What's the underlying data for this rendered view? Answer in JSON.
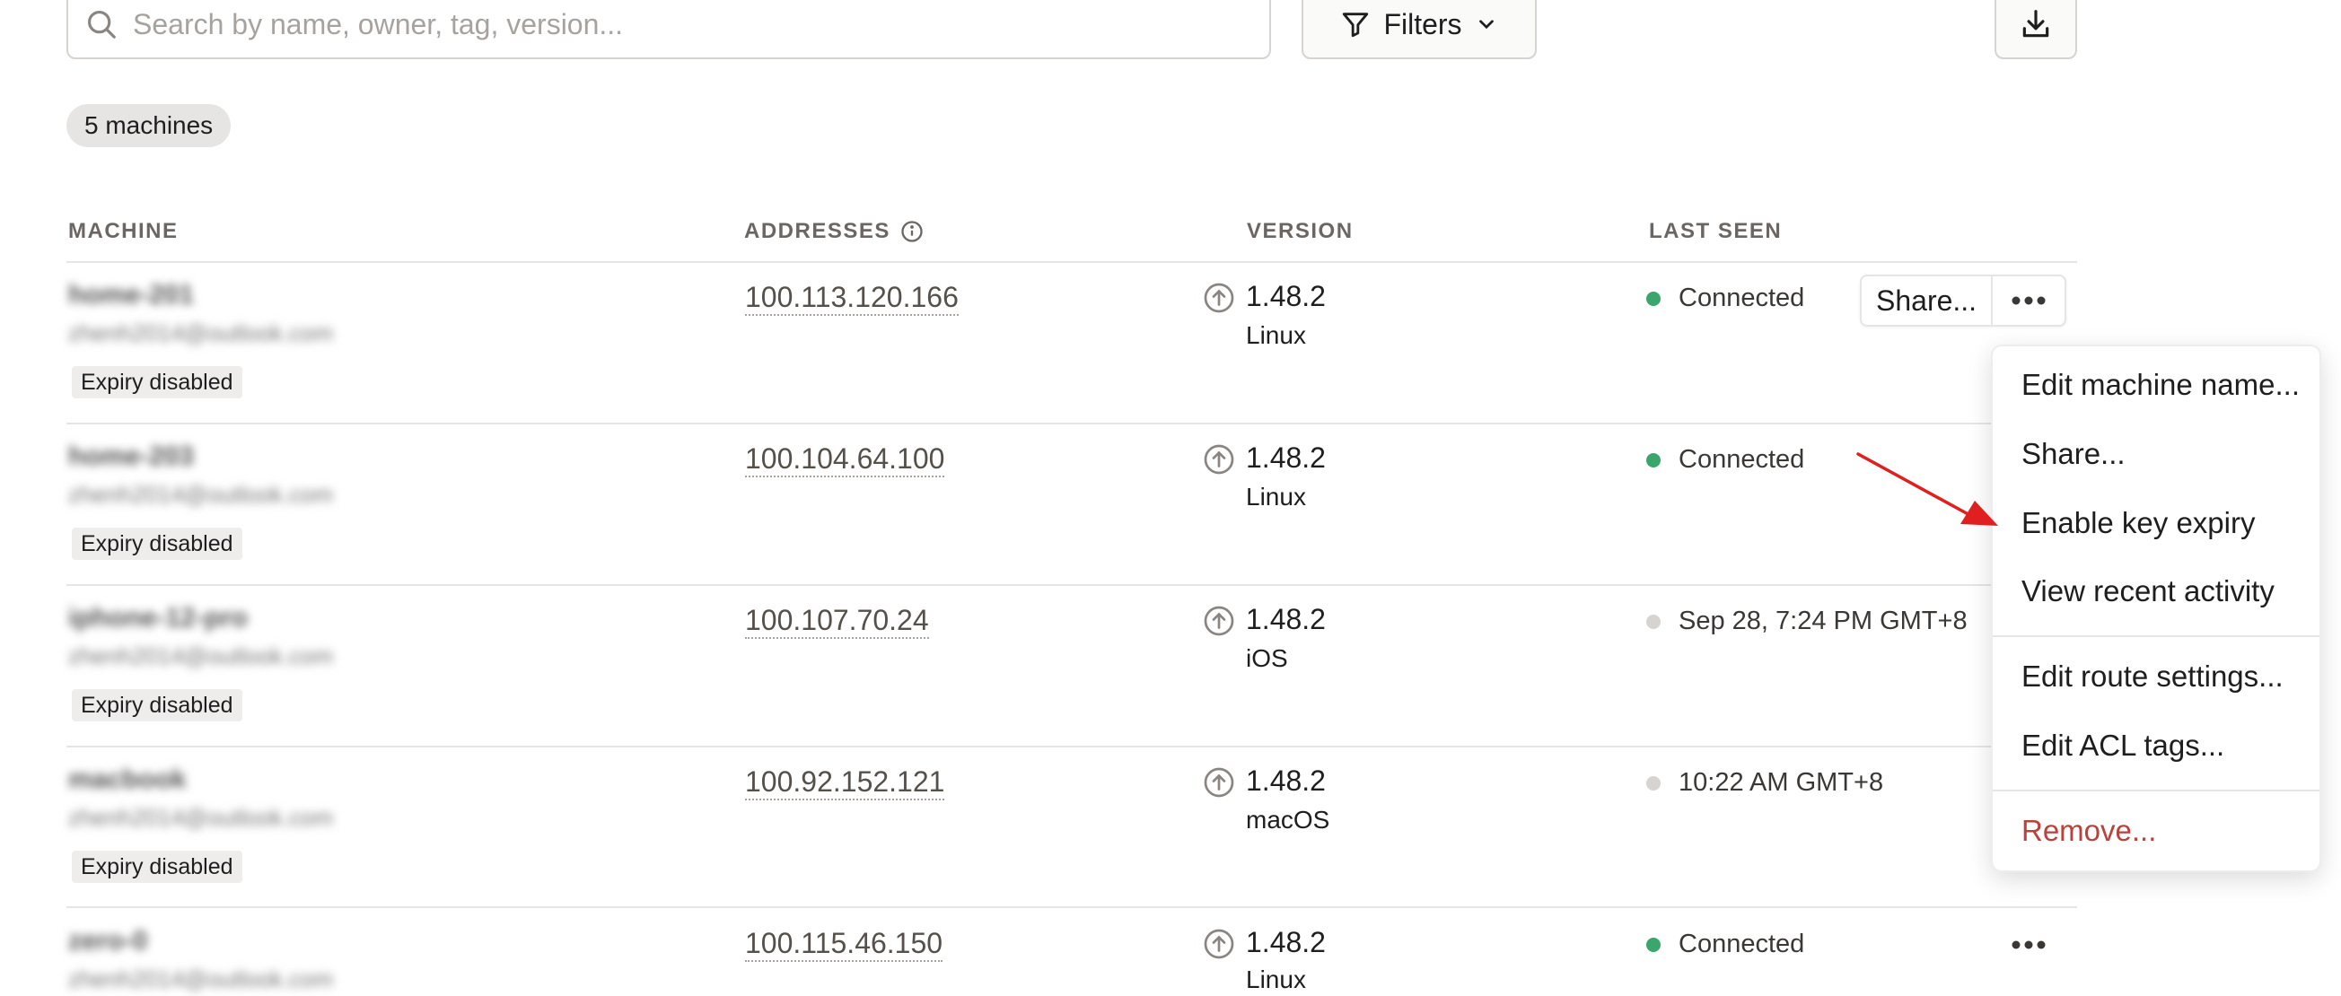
{
  "toolbar": {
    "search_placeholder": "Search by name, owner, tag, version...",
    "filters_label": "Filters",
    "download_icon": "download-icon"
  },
  "machine_count": "5 machines",
  "columns": {
    "machine": "MACHINE",
    "addresses": "ADDRESSES",
    "version": "VERSION",
    "last_seen": "LAST SEEN"
  },
  "rows": [
    {
      "name": "home-201",
      "owner": "zhenh2014@outlook.com",
      "badge": "Expiry disabled",
      "address": "100.113.120.166",
      "version": "1.48.2",
      "os": "Linux",
      "last_seen": "Connected",
      "status": "connected"
    },
    {
      "name": "home-203",
      "owner": "zhenh2014@outlook.com",
      "badge": "Expiry disabled",
      "address": "100.104.64.100",
      "version": "1.48.2",
      "os": "Linux",
      "last_seen": "Connected",
      "status": "connected"
    },
    {
      "name": "iphone-12-pro",
      "owner": "zhenh2014@outlook.com",
      "badge": "Expiry disabled",
      "address": "100.107.70.24",
      "version": "1.48.2",
      "os": "iOS",
      "last_seen": "Sep 28, 7:24 PM GMT+8",
      "status": "offline"
    },
    {
      "name": "macbook",
      "owner": "zhenh2014@outlook.com",
      "badge": "Expiry disabled",
      "address": "100.92.152.121",
      "version": "1.48.2",
      "os": "macOS",
      "last_seen": "10:22 AM GMT+8",
      "status": "offline"
    },
    {
      "name": "zero-0",
      "owner": "zhenh2014@outlook.com",
      "badge": "",
      "address": "100.115.46.150",
      "version": "1.48.2",
      "os": "Linux",
      "last_seen": "Connected",
      "status": "connected"
    }
  ],
  "row_actions": {
    "share_label": "Share...",
    "more_icon": "more-horizontal-icon"
  },
  "context_menu": {
    "items": [
      {
        "label": "Edit machine name..."
      },
      {
        "label": "Share..."
      },
      {
        "label": "Enable key expiry"
      },
      {
        "label": "View recent activity"
      },
      {
        "label": "Edit route settings..."
      },
      {
        "label": "Edit ACL tags..."
      },
      {
        "label": "Remove...",
        "danger": true
      }
    ]
  },
  "colors": {
    "connected": "#3aa66b",
    "offline": "#d6d3d1",
    "danger": "#b9423b",
    "annotation_arrow": "#e02020"
  }
}
